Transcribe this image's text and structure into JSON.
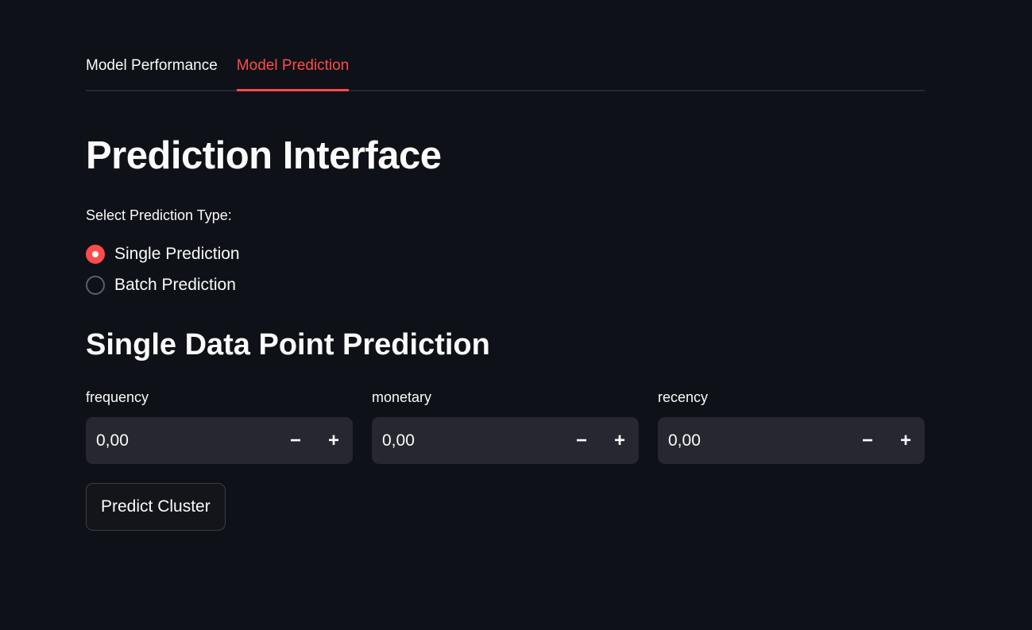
{
  "tabs": [
    {
      "label": "Model Performance",
      "active": false
    },
    {
      "label": "Model Prediction",
      "active": true
    }
  ],
  "title": "Prediction Interface",
  "prediction_type": {
    "label": "Select Prediction Type:",
    "options": [
      "Single Prediction",
      "Batch Prediction"
    ],
    "selected": "Single Prediction"
  },
  "section_title": "Single Data Point Prediction",
  "inputs": [
    {
      "label": "frequency",
      "value": "0,00"
    },
    {
      "label": "monetary",
      "value": "0,00"
    },
    {
      "label": "recency",
      "value": "0,00"
    }
  ],
  "stepper": {
    "minus": "−",
    "plus": "+"
  },
  "predict_button": "Predict Cluster",
  "colors": {
    "accent": "#ff4b4b",
    "background": "#0e1117",
    "input_bg": "#262730"
  }
}
